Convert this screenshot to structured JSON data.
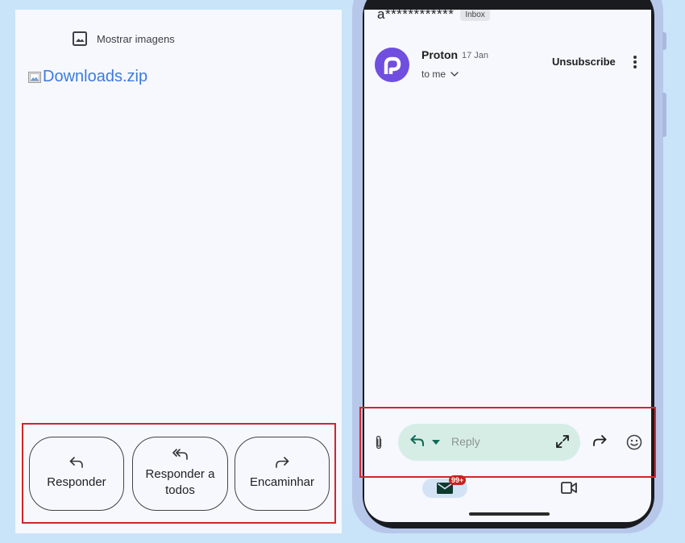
{
  "left": {
    "show_images_label": "Mostrar imagens",
    "attachment_name": "Downloads.zip",
    "actions": {
      "reply": "Responder",
      "reply_all_line1": "Responder a",
      "reply_all_line2": "todos",
      "forward": "Encaminhar"
    }
  },
  "right": {
    "subject": "a************",
    "label": "Inbox",
    "sender": {
      "name": "Proton",
      "date": "17 Jan",
      "recipient": "to me"
    },
    "unsubscribe": "Unsubscribe",
    "reply_placeholder": "Reply",
    "notification_count": "99+"
  },
  "colors": {
    "highlight": "#d0262a",
    "avatar": "#6f4ee0",
    "link": "#3a7be0",
    "reply_pill": "#d6ede6"
  }
}
